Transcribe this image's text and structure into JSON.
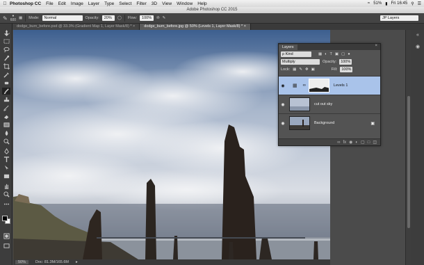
{
  "menubar": {
    "app": "Photoshop CC",
    "items": [
      "File",
      "Edit",
      "Image",
      "Layer",
      "Type",
      "Select",
      "Filter",
      "3D",
      "View",
      "Window",
      "Help"
    ],
    "battery": "51%",
    "time": "Fri 16:45"
  },
  "window_title": "Adobe Photoshop CC 2015",
  "options": {
    "brush_size": "600",
    "mode_label": "Mode:",
    "mode_value": "Normal",
    "opacity_label": "Opacity:",
    "opacity_value": "20%",
    "flow_label": "Flow:",
    "flow_value": "100%",
    "workspace": "JP Layers"
  },
  "tabs": [
    {
      "label": "dodge_burn_before.psd @ 33.3% (Gradient Map 1, Layer Mask/8) *"
    },
    {
      "label": "dodge_burn_before.jpg @ 50% (Levels 1, Layer Mask/8) *"
    }
  ],
  "status": {
    "zoom": "50%",
    "doc": "Doc: 81.3M/165.6M"
  },
  "layers_panel": {
    "title": "Layers",
    "kind": "ρ Kind",
    "blend_mode": "Multiply",
    "opacity_label": "Opacity:",
    "opacity_value": "100%",
    "lock_label": "Lock:",
    "fill_label": "Fill:",
    "fill_value": "100%",
    "layers": [
      {
        "name": "Levels 1",
        "selected": true
      },
      {
        "name": "cut out sky",
        "selected": false
      },
      {
        "name": "Background",
        "selected": false
      }
    ]
  },
  "colors": {
    "accent": "#a9c3ea",
    "panel": "#535353",
    "menubar": "#e6e6e6"
  }
}
